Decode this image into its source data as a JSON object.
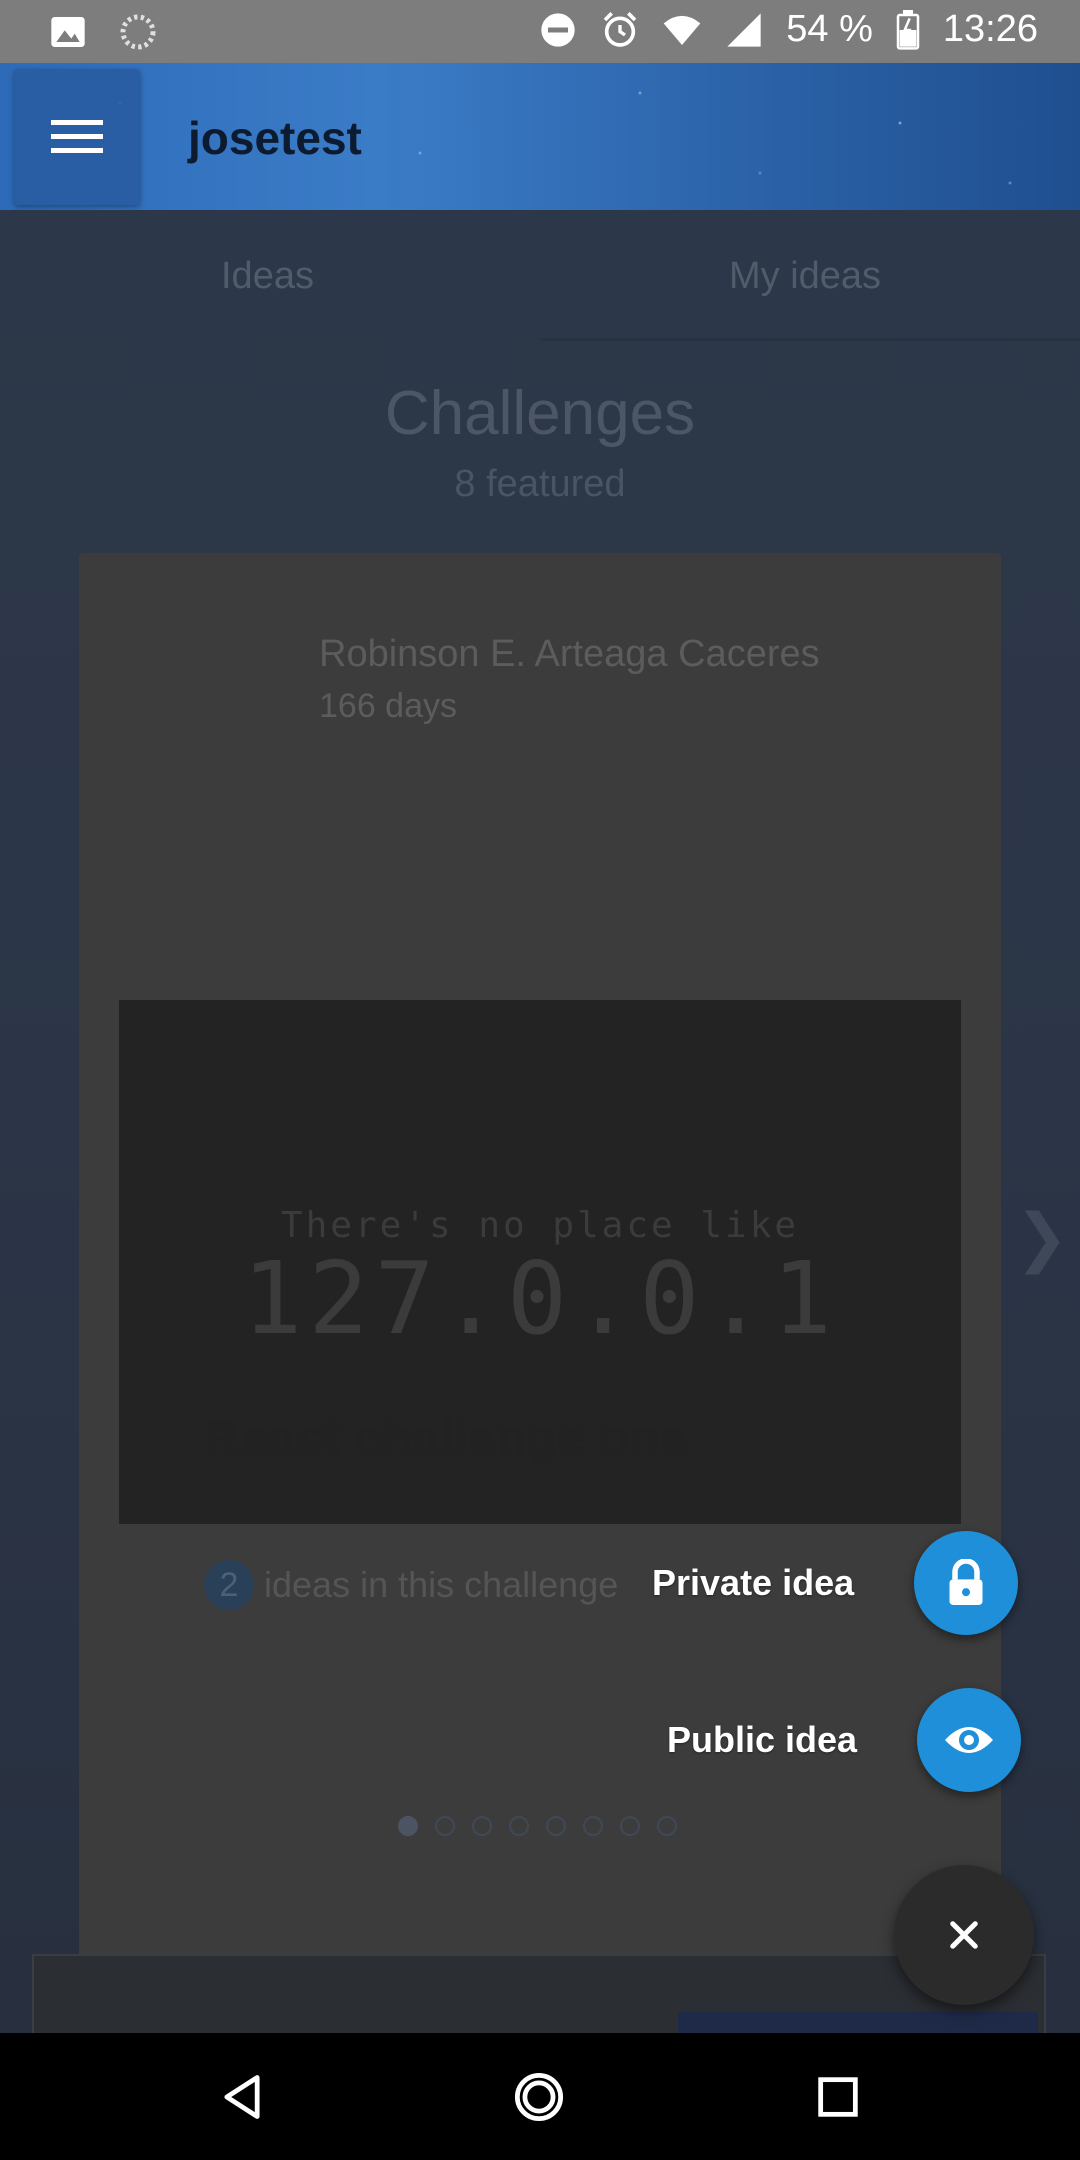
{
  "status_bar": {
    "battery": "54 %",
    "time": "13:26",
    "left_icons": [
      "image-icon",
      "sync-icon"
    ],
    "right_icons": [
      "dnd-icon",
      "alarm-icon",
      "wifi-icon",
      "signal-icon",
      "battery-icon"
    ]
  },
  "app_bar": {
    "title": "josetest",
    "menu_icon": "hamburger-menu-icon"
  },
  "tabs": [
    {
      "label": "Ideas"
    },
    {
      "label": "My ideas"
    }
  ],
  "challenges": {
    "title": "Challenges",
    "subtitle": "8 featured",
    "dot_count": 8,
    "active_dot": 0
  },
  "card": {
    "author": "Robinson E. Arteaga Caceres",
    "days": "166 days",
    "image_text_line1": "There's no place like",
    "image_text_line2": "127.0.0.1",
    "title": "React challenge one",
    "ideas_count": "2",
    "ideas_label": "ideas in this challenge"
  },
  "next_arrow": "❯",
  "speed_dial": {
    "private_label": "Private idea",
    "private_icon": "lock-icon",
    "public_label": "Public idea",
    "public_icon": "eye-icon",
    "close_icon": "close-icon",
    "accent_color": "#1e8fd8"
  },
  "nav_bar": {
    "back_icon": "back-triangle-icon",
    "home_icon": "home-circle-icon",
    "recents_icon": "recents-square-icon"
  }
}
